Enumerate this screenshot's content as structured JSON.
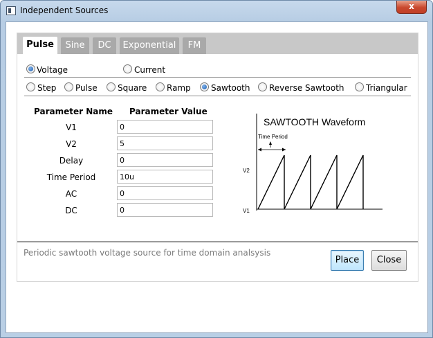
{
  "window": {
    "title": "Independent Sources",
    "close_glyph": "x"
  },
  "tabs": [
    {
      "label": "Pulse",
      "active": true
    },
    {
      "label": "Sine",
      "active": false
    },
    {
      "label": "DC",
      "active": false
    },
    {
      "label": "Exponential",
      "active": false
    },
    {
      "label": "FM",
      "active": false
    }
  ],
  "source_type": {
    "voltage": {
      "label": "Voltage",
      "checked": true
    },
    "current": {
      "label": "Current",
      "checked": false
    }
  },
  "waveforms": [
    {
      "label": "Step",
      "checked": false
    },
    {
      "label": "Pulse",
      "checked": false
    },
    {
      "label": "Square",
      "checked": false
    },
    {
      "label": "Ramp",
      "checked": false
    },
    {
      "label": "Sawtooth",
      "checked": true
    },
    {
      "label": "Reverse Sawtooth",
      "checked": false
    },
    {
      "label": "Triangular",
      "checked": false
    }
  ],
  "parameters": {
    "name_header": "Parameter Name",
    "value_header": "Parameter Value",
    "rows": [
      {
        "name": "V1",
        "value": "0"
      },
      {
        "name": "V2",
        "value": "5"
      },
      {
        "name": "Delay",
        "value": "0"
      },
      {
        "name": "Time Period",
        "value": "10u"
      },
      {
        "name": "AC",
        "value": "0"
      },
      {
        "name": "DC",
        "value": "0"
      }
    ]
  },
  "diagram": {
    "title": "SAWTOOTH Waveform",
    "period_label": "Time Period",
    "high_label": "V2",
    "low_label": "V1"
  },
  "description": "Periodic sawtooth voltage source for time domain analsysis",
  "buttons": {
    "place": "Place",
    "close": "Close"
  },
  "icons": {
    "app": "app-window-icon",
    "close": "close-icon",
    "radio": "radio-button-icon"
  },
  "colors": {
    "active_tab_bg": "#ffffff",
    "inactive_tab_bg": "#a9a9a9",
    "tabbar_bg": "#c8c8c8",
    "description_text": "#7a7a7a"
  }
}
